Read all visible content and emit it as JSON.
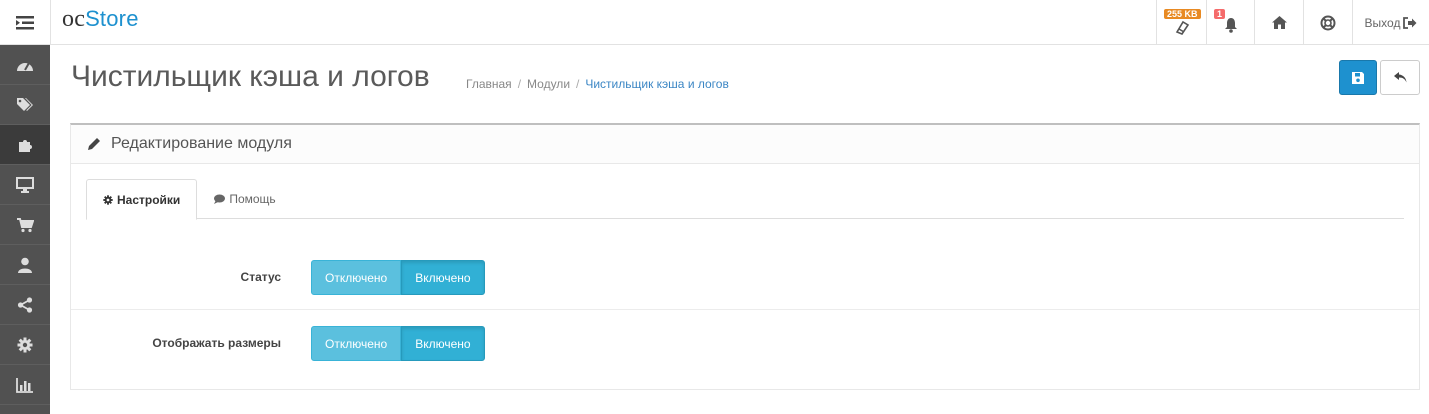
{
  "header": {
    "logo_oc": "oc",
    "logo_store": "Store",
    "cache_badge": "255 KB",
    "notification_count": "1",
    "logout_label": "Выход"
  },
  "sidebar": {
    "items": [
      {
        "icon": "dashboard-icon"
      },
      {
        "icon": "tags-icon"
      },
      {
        "icon": "puzzle-icon",
        "active": true
      },
      {
        "icon": "desktop-icon"
      },
      {
        "icon": "cart-icon"
      },
      {
        "icon": "user-icon"
      },
      {
        "icon": "share-icon"
      },
      {
        "icon": "cog-icon"
      },
      {
        "icon": "bar-chart-icon"
      }
    ]
  },
  "page": {
    "title": "Чистильщик кэша и логов",
    "breadcrumb": [
      "Главная",
      "Модули",
      "Чистильщик кэша и логов"
    ]
  },
  "panel": {
    "heading": "Редактирование модуля",
    "tabs": [
      {
        "label": "Настройки",
        "active": true
      },
      {
        "label": "Помощь",
        "active": false
      }
    ],
    "fields": [
      {
        "label": "Статус",
        "off": "Отключено",
        "on": "Включено",
        "selected": "on"
      },
      {
        "label": "Отображать размеры",
        "off": "Отключено",
        "on": "Включено",
        "selected": "on"
      }
    ]
  },
  "colors": {
    "primary": "#1e91cf",
    "info": "#5bc0de",
    "sidebar": "#515151"
  }
}
